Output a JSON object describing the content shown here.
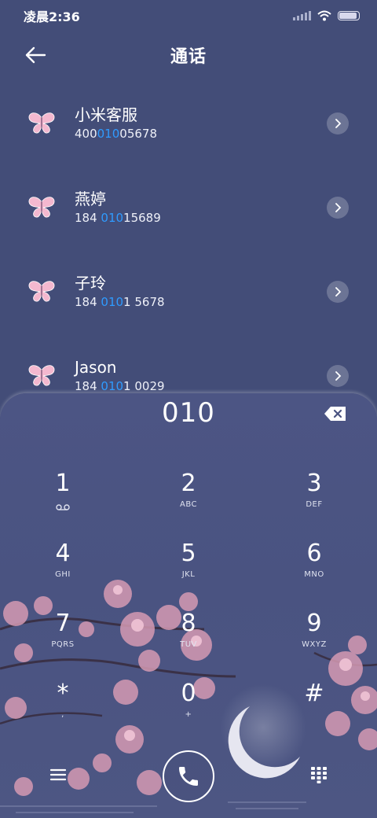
{
  "status": {
    "time": "凌晨2:36"
  },
  "header": {
    "title": "通话"
  },
  "contacts": [
    {
      "name": "小米客服",
      "num_pre": "400",
      "num_hl": "010",
      "num_post": "05678",
      "icon": "butterfly-icon"
    },
    {
      "name": "燕婷",
      "num_pre": "184 ",
      "num_hl": "010",
      "num_post": "15689",
      "icon": "butterfly-icon"
    },
    {
      "name": "子玲",
      "num_pre": "184 ",
      "num_hl": "010",
      "num_post": "1 5678",
      "icon": "butterfly-icon"
    },
    {
      "name": "Jason",
      "num_pre": "184 ",
      "num_hl": "010",
      "num_post": "1 0029",
      "icon": "butterfly-icon"
    }
  ],
  "dialer": {
    "input": "010",
    "keys": [
      {
        "digit": "1",
        "letters": ""
      },
      {
        "digit": "2",
        "letters": "ABC"
      },
      {
        "digit": "3",
        "letters": "DEF"
      },
      {
        "digit": "4",
        "letters": "GHI"
      },
      {
        "digit": "5",
        "letters": "JKL"
      },
      {
        "digit": "6",
        "letters": "MNO"
      },
      {
        "digit": "7",
        "letters": "PQRS"
      },
      {
        "digit": "8",
        "letters": "TUV"
      },
      {
        "digit": "9",
        "letters": "WXYZ"
      },
      {
        "digit": "*",
        "letters": ","
      },
      {
        "digit": "0",
        "letters": "+"
      },
      {
        "digit": "#",
        "letters": ""
      }
    ]
  },
  "colors": {
    "background": "#434d78",
    "highlight": "#2f9bff",
    "butterfly": "#f4b8cf"
  }
}
